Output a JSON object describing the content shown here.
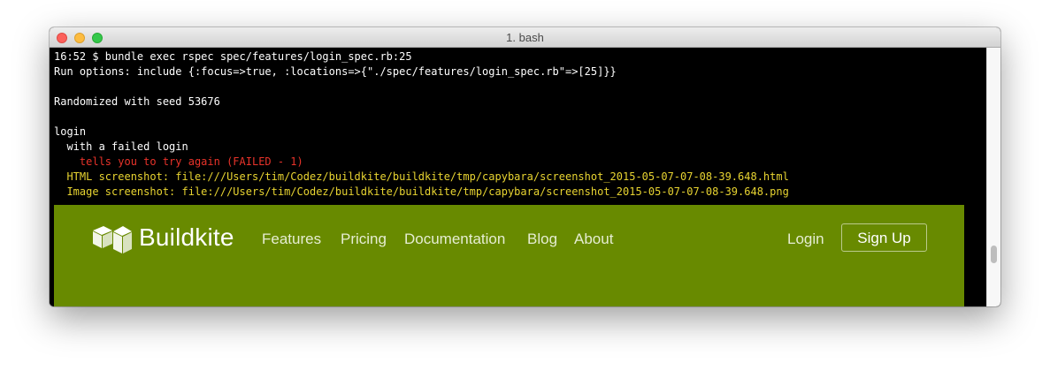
{
  "window": {
    "title": "1. bash"
  },
  "terminal": {
    "lines": [
      {
        "text": "16:52 $ bundle exec rspec spec/features/login_spec.rb:25",
        "color": "#ffffff"
      },
      {
        "text": "Run options: include {:focus=>true, :locations=>{\"./spec/features/login_spec.rb\"=>[25]}}",
        "color": "#ffffff"
      },
      {
        "text": "Randomized with seed 53676",
        "color": "#ffffff"
      },
      {
        "text": "login",
        "color": "#ffffff"
      },
      {
        "text": "  with a failed login",
        "color": "#ffffff"
      },
      {
        "text": "    tells you to try again (FAILED - 1)",
        "color": "#e8332a"
      },
      {
        "text": "  HTML screenshot: file:///Users/tim/Codez/buildkite/buildkite/tmp/capybara/screenshot_2015-05-07-07-08-39.648.html",
        "color": "#e8d431"
      },
      {
        "text": "  Image screenshot: file:///Users/tim/Codez/buildkite/buildkite/tmp/capybara/screenshot_2015-05-07-07-08-39.648.png",
        "color": "#e8d431"
      }
    ]
  },
  "screenshot": {
    "brand": "Buildkite",
    "background": "#688a00",
    "nav": [
      "Features",
      "Pricing",
      "Documentation",
      "Blog",
      "About"
    ],
    "login": "Login",
    "signup": "Sign Up"
  },
  "icons": [
    "close-button-icon",
    "minimize-button-icon",
    "zoom-button-icon",
    "buildkite-logo-icon"
  ]
}
